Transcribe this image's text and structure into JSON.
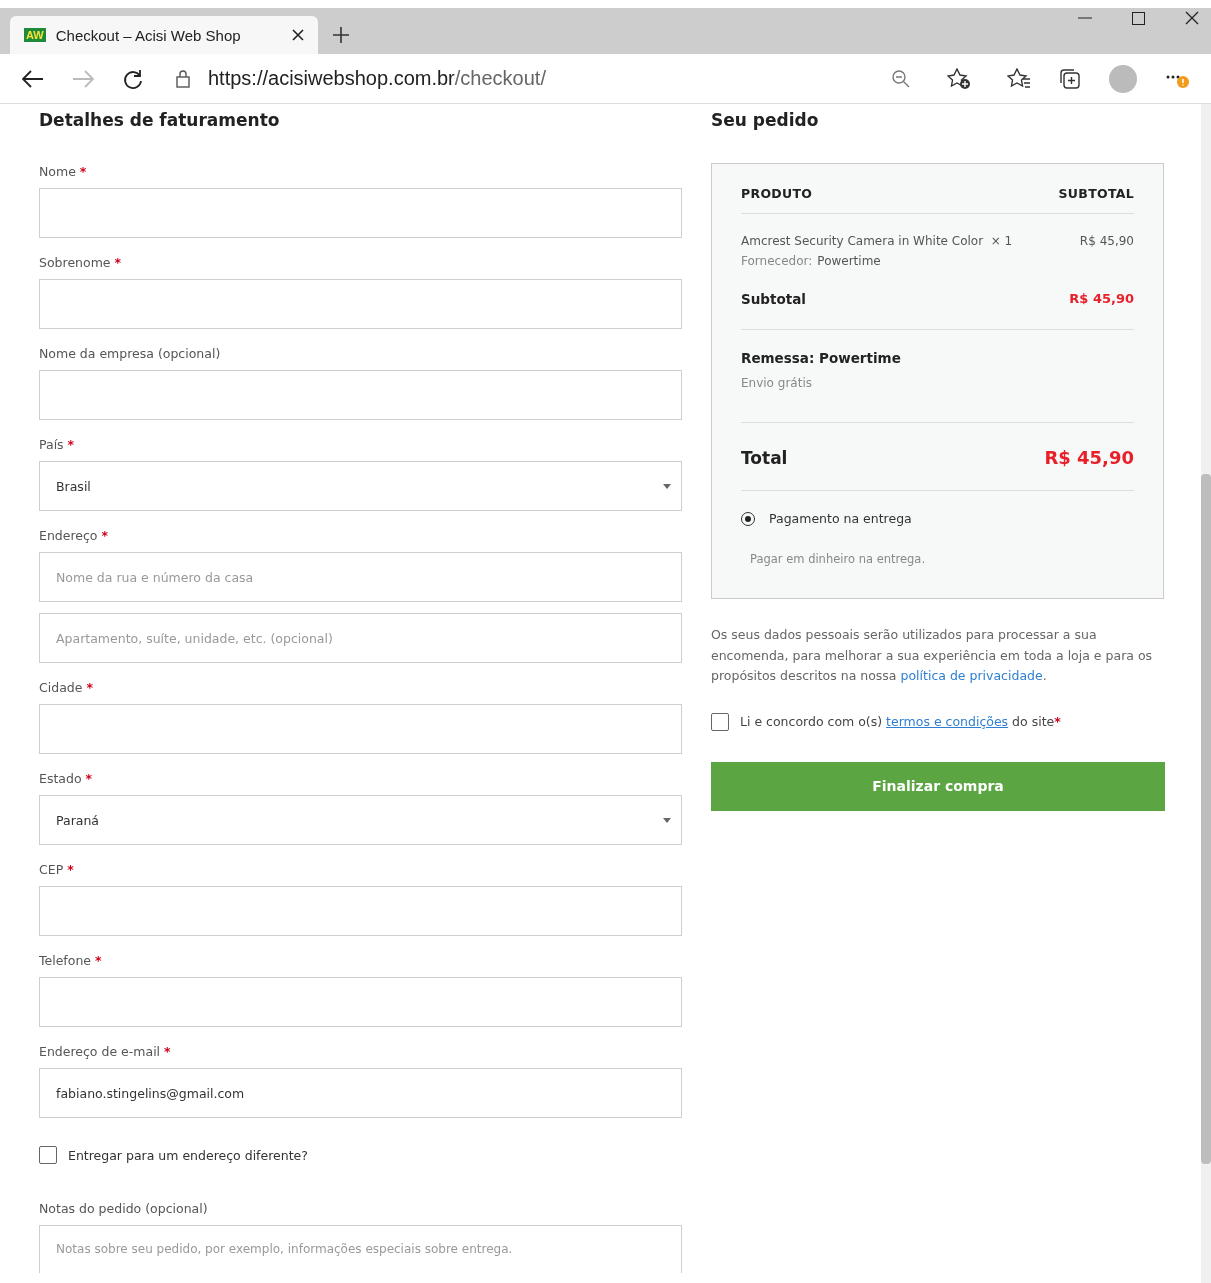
{
  "browser": {
    "tab": {
      "favicon_text": "AW",
      "title": "Checkout – Acisi Web Shop"
    },
    "url": {
      "host": "https://acisiwebshop.com.br",
      "path": "/checkout/"
    }
  },
  "billing": {
    "title": "Detalhes de faturamento",
    "required_mark": "*",
    "fields": [
      {
        "kind": "text",
        "label": "Nome",
        "required": true
      },
      {
        "kind": "text",
        "label": "Sobrenome",
        "required": true
      },
      {
        "kind": "text",
        "label": "Nome da empresa (opcional)",
        "required": false
      },
      {
        "kind": "select",
        "label": "País",
        "required": true,
        "value": "Brasil"
      },
      {
        "kind": "text",
        "label": "Endereço",
        "required": true,
        "placeholders": [
          "Nome da rua e número da casa",
          "Apartamento, suíte, unidade, etc. (opcional)"
        ]
      },
      {
        "kind": "text",
        "label": "Cidade",
        "required": true
      },
      {
        "kind": "select",
        "label": "Estado",
        "required": true,
        "value": "Paraná"
      },
      {
        "kind": "text",
        "label": "CEP",
        "required": true
      },
      {
        "kind": "text",
        "label": "Telefone",
        "required": true
      },
      {
        "kind": "text",
        "label": "Endereço de e-mail",
        "required": true,
        "value": "fabiano.stingelins@gmail.com"
      }
    ],
    "ship_different": {
      "label": "Entregar para um endereço diferente?",
      "checked": false
    },
    "notes": {
      "label": "Notas do pedido (opcional)",
      "placeholder": "Notas sobre seu pedido, por exemplo, informações especiais sobre entrega."
    }
  },
  "order": {
    "title": "Seu pedido",
    "columns": [
      "PRODUTO",
      "SUBTOTAL"
    ],
    "item": {
      "name": "Amcrest Security Camera in White Color",
      "qty": "× 1",
      "vendor_label": "Fornecedor:",
      "vendor": "Powertime",
      "price": "R$ 45,90"
    },
    "subtotal": {
      "label": "Subtotal",
      "value": "R$ 45,90"
    },
    "shipping": {
      "title": "Remessa: Powertime",
      "method": "Envio grátis"
    },
    "total": {
      "label": "Total",
      "value": "R$ 45,90"
    },
    "payment": {
      "label": "Pagamento na entrega",
      "selected": true,
      "description": "Pagar em dinheiro na entrega."
    },
    "privacy": {
      "before": "Os seus dados pessoais serão utilizados para processar a sua encomenda, para melhorar a sua experiência em toda a loja e para os propósitos descritos na nossa ",
      "link": "política de privacidade",
      "after": "."
    },
    "terms": {
      "checked": false,
      "before": "Li e concordo com o(s) ",
      "link": "termos e condições",
      "after": " do site",
      "required": "*"
    },
    "button": "Finalizar compra"
  }
}
